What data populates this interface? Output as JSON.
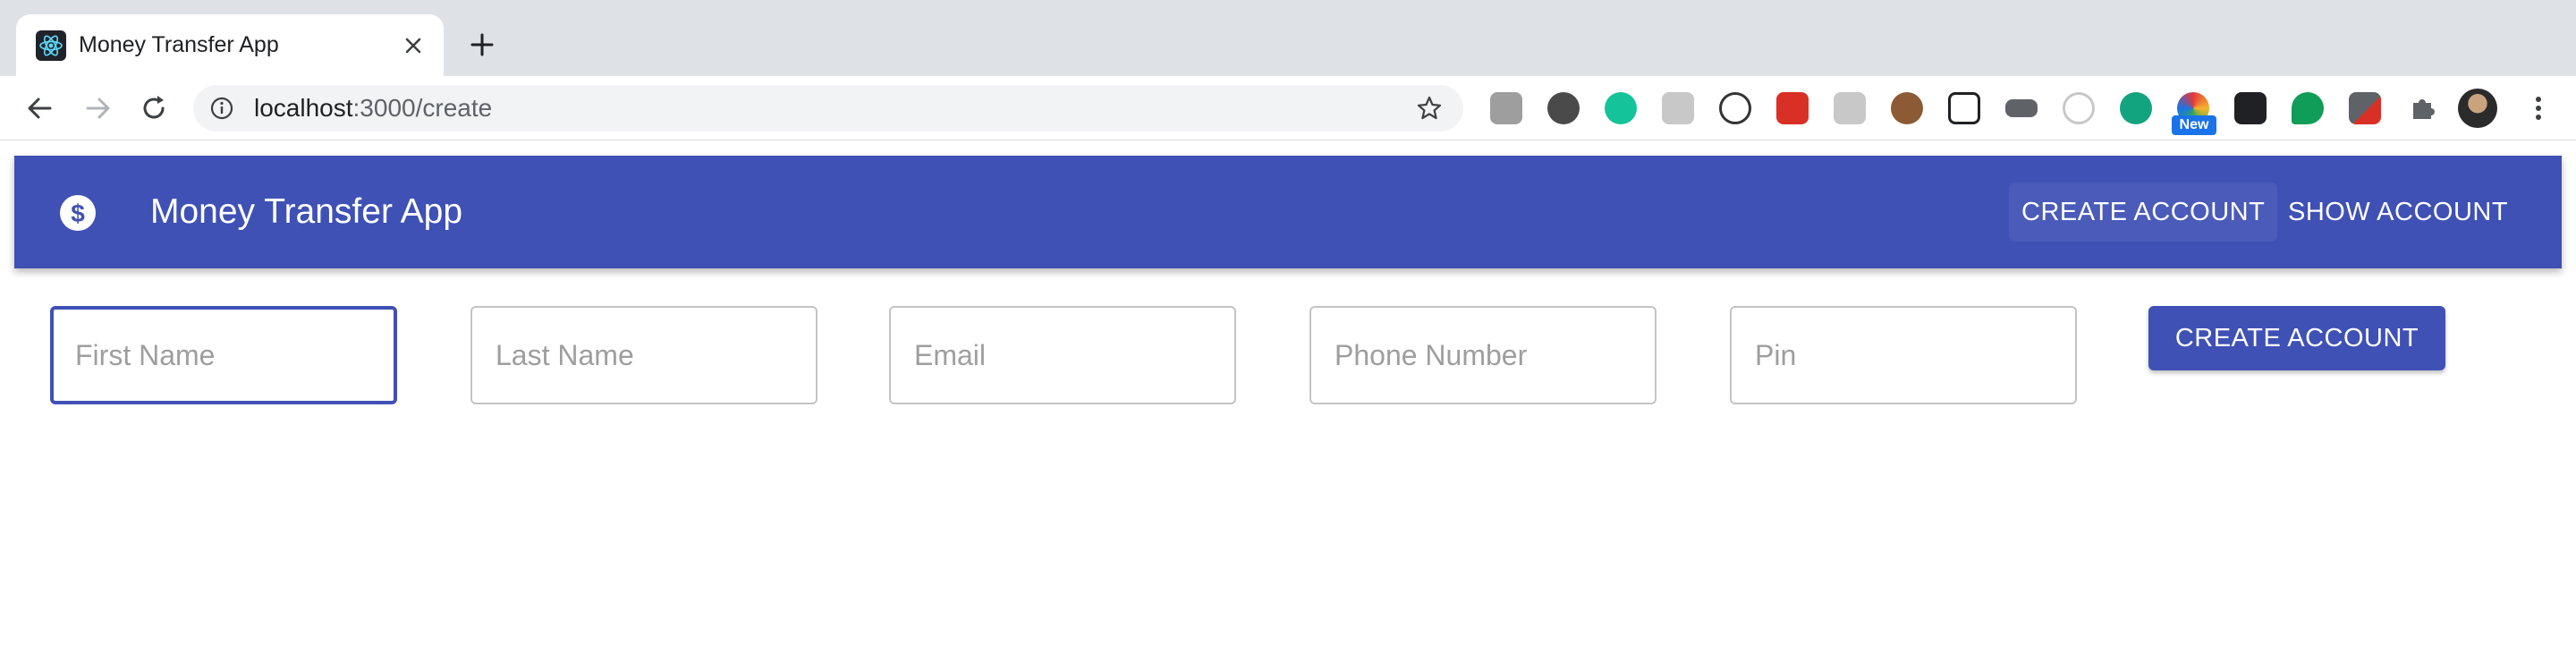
{
  "browser": {
    "tab": {
      "title": "Money Transfer App",
      "favicon": "react-logo-icon"
    },
    "address": {
      "host": "localhost",
      "path": ":3000/create"
    },
    "extensions": [
      {
        "name": "camera-extension-icon",
        "color": "#8a8a8a"
      },
      {
        "name": "circle-extension-icon",
        "color": "#5a5a5a"
      },
      {
        "name": "grammarly-extension-icon",
        "color": "#15c39a"
      },
      {
        "name": "b-extension-icon",
        "color": "#bdbdbd"
      },
      {
        "name": "code-extension-icon",
        "color": "#333333"
      },
      {
        "name": "red-grid-extension-icon",
        "color": "#d93025"
      },
      {
        "name": "chat-extension-icon",
        "color": "#bdbdbd"
      },
      {
        "name": "cookie-extension-icon",
        "color": "#8d5a36"
      },
      {
        "name": "document-extension-icon",
        "color": "#202124"
      },
      {
        "name": "tag-extension-icon",
        "color": "#5f6368"
      },
      {
        "name": "target-extension-icon",
        "color": "#bdbdbd"
      },
      {
        "name": "a-extension-icon",
        "color": "#12a37f"
      },
      {
        "name": "color-extension-icon",
        "color": "#e5383b"
      },
      {
        "name": "cube-extension-icon",
        "color": "#202124"
      },
      {
        "name": "green-bubble-extension-icon",
        "color": "#0f9d58"
      },
      {
        "name": "dropper-extension-icon",
        "color": "#d93025"
      },
      {
        "name": "puzzle-extension-icon",
        "color": "#5f6368"
      }
    ],
    "new_badge": "New"
  },
  "app": {
    "title": "Money Transfer App",
    "logo": "dollar-circle-icon",
    "nav": {
      "create": "CREATE ACCOUNT",
      "show": "SHOW ACCOUNT"
    },
    "form": {
      "first_name": {
        "placeholder": "First Name",
        "value": ""
      },
      "last_name": {
        "placeholder": "Last Name",
        "value": ""
      },
      "email": {
        "placeholder": "Email",
        "value": ""
      },
      "phone": {
        "placeholder": "Phone Number",
        "value": ""
      },
      "pin": {
        "placeholder": "Pin",
        "value": ""
      },
      "submit": "CREATE ACCOUNT"
    },
    "colors": {
      "primary": "#3f51b5",
      "on_primary": "#ffffff"
    }
  }
}
